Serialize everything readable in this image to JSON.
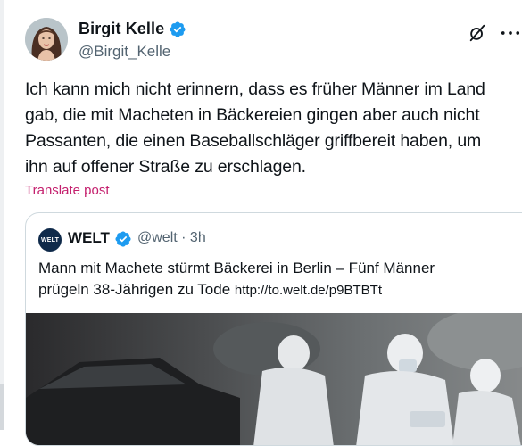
{
  "author": {
    "display_name": "Birgit Kelle",
    "handle": "@Birgit_Kelle",
    "verified_icon": "verified-badge-icon",
    "avatar": "avatar"
  },
  "post": {
    "lines": [
      "Ich kann mich nicht erinnern, dass es früher Männer im Land",
      "gab, die mit Macheten in Bäckereien gingen aber auch nicht",
      "Passanten, die einen Baseballschläger griffbereit haben, um",
      "ihn auf offener Straße zu erschlagen."
    ],
    "translate_label": "Translate post"
  },
  "quote": {
    "logo_text": "WELT",
    "display_name": "WELT",
    "handle_time": "@welt · 3h",
    "text_line1": "Mann mit Machete stürmt Bäckerei in Berlin – Fünf Männer",
    "text_line2": "prügeln 38-Jährigen zu Tode ",
    "link": "http://to.welt.de/p9BTBTt"
  },
  "colors": {
    "accent_pink": "#c41f6d",
    "verified_blue": "#1d9bf0",
    "secondary_text": "#536471"
  },
  "icons": [
    "grok-icon",
    "more-options-icon",
    "verified-badge-icon"
  ]
}
